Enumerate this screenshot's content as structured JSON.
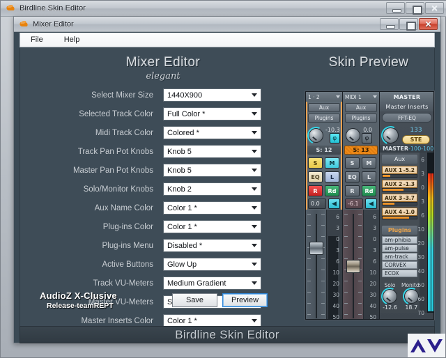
{
  "outer_window": {
    "title": "Birdline Skin Editor",
    "icon": "app-icon",
    "controls": {
      "minimize": "–",
      "maximize": "□",
      "close": "✕"
    }
  },
  "inner_window": {
    "title": "Mixer Editor",
    "icon": "app-icon",
    "controls": {
      "minimize": "–",
      "maximize": "□",
      "close": "✕"
    },
    "menu": [
      "File",
      "Help"
    ]
  },
  "editor": {
    "heading": "Mixer Editor",
    "subheading": "elegant",
    "rows": [
      {
        "label": "Select Mixer Size",
        "value": "1440X900"
      },
      {
        "label": "Selected Track Color",
        "value": "Full Color *"
      },
      {
        "label": "Midi Track Color",
        "value": "Colored *"
      },
      {
        "label": "Track Pan Pot Knobs",
        "value": "Knob 5"
      },
      {
        "label": "Master Pan Pot Knobs",
        "value": "Knob 5"
      },
      {
        "label": "Solo/Monitor Knobs",
        "value": "Knob 2"
      },
      {
        "label": "Aux Name Color",
        "value": "Color 1 *"
      },
      {
        "label": "Plug-ins Color",
        "value": "Color 1 *"
      },
      {
        "label": "Plug-ins Menu",
        "value": "Disabled *"
      },
      {
        "label": "Active Buttons",
        "value": "Glow Up"
      },
      {
        "label": "Track VU-Meters",
        "value": "Medium Gradient"
      },
      {
        "label": "Master VU-Meters",
        "value": "Solid Gradient"
      },
      {
        "label": "Master Inserts Color",
        "value": "Color 1 *"
      }
    ],
    "brand_main": "AudioZ X-Clusive",
    "brand_sub": "Release-teamREPT",
    "save_label": "Save",
    "preview_label": "Preview"
  },
  "preview": {
    "title": "Skin Preview",
    "channels": [
      {
        "name": "1 · 2",
        "aux_label": "Aux",
        "plugins_label": "Plugins",
        "pan_value": "-10.3",
        "phase_glyph": "φ",
        "phase_on": true,
        "send_label": "S: 12",
        "send_hot": false,
        "buttons": {
          "solo": "S",
          "mute": "M",
          "eq": "EQ",
          "l": "L",
          "rec": "R",
          "read": "Rd"
        },
        "volume": "0.0",
        "speaker_glyph": "◀"
      },
      {
        "name": "MIDI 1",
        "aux_label": "Aux",
        "plugins_label": "Plugins",
        "pan_value": "0.0",
        "phase_glyph": "φ",
        "phase_on": false,
        "send_label": "S: 13",
        "send_hot": true,
        "buttons": {
          "solo": "S",
          "mute": "M",
          "eq": "EQ",
          "l": "L",
          "rec": "R",
          "read": "Rd"
        },
        "volume": "-6.1",
        "speaker_glyph": "◀"
      }
    ],
    "master": {
      "title": "MASTER",
      "inserts_label": "Master Inserts",
      "insert_slot": "FFT-EQ",
      "pan_value": "133",
      "ste_label": "STE",
      "readout_label": "MASTER",
      "readout_left": "-100",
      "readout_right": "-100"
    },
    "aux_panel": {
      "title": "Aux",
      "sends": [
        {
          "name": "AUX 1",
          "value": "-5.2",
          "fill_pct": 22
        },
        {
          "name": "AUX 2",
          "value": "-1.3",
          "fill_pct": 62
        },
        {
          "name": "AUX 3",
          "value": "-3.7",
          "fill_pct": 35
        },
        {
          "name": "AUX 4",
          "value": "-1.0",
          "fill_pct": 78
        }
      ]
    },
    "plugins_panel": {
      "title": "Plugins",
      "items": [
        "am-phibia",
        "am-pulse",
        "am-track",
        "CORVEX",
        "ECOX"
      ]
    },
    "solo_monitor": {
      "solo_label": "Solo",
      "solo_value": "-12.6",
      "monitor_label": "Monitor",
      "monitor_value": "18.7"
    },
    "track_scale": [
      "6",
      "3",
      "0",
      "3",
      "6",
      "10",
      "20",
      "30",
      "40",
      "50"
    ],
    "master_scale": [
      "6",
      "3",
      "0",
      "3",
      "6",
      "10",
      "20",
      "30",
      "40",
      "50",
      "60",
      "70"
    ]
  },
  "footer": {
    "title": "Birdline Skin Editor",
    "logo": "audioz-logo"
  }
}
